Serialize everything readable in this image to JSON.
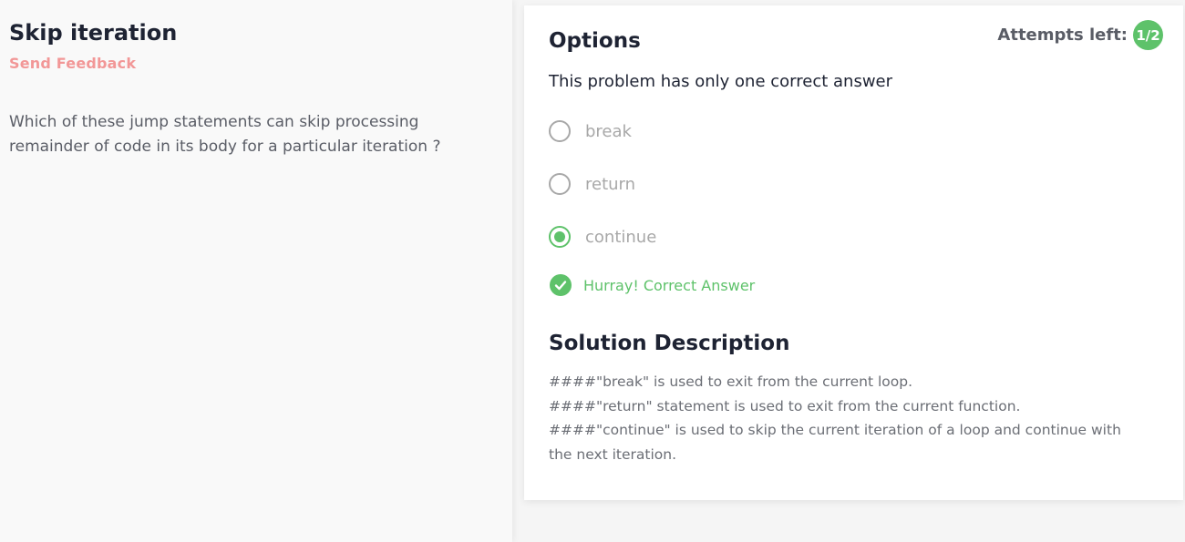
{
  "problem": {
    "title": "Skip iteration",
    "send_feedback": "Send Feedback",
    "question": "Which of these jump statements can skip processing remainder of code in its body for a particular iteration ?"
  },
  "options_panel": {
    "heading": "Options",
    "attempts_label": "Attempts left:",
    "attempts_value": "1/2",
    "subtitle": "This problem has only one correct answer",
    "options": [
      {
        "label": "break",
        "selected": false
      },
      {
        "label": "return",
        "selected": false
      },
      {
        "label": "continue",
        "selected": true
      }
    ],
    "result": "Hurray! Correct Answer"
  },
  "solution": {
    "heading": "Solution Description",
    "lines": [
      "####\"break\" is used to exit from the current loop.",
      "####\"return\" statement is used to exit from the current function.",
      "####\"continue\" is used to skip the current iteration of a loop and continue with the next iteration."
    ]
  },
  "colors": {
    "accent_green": "#5ec26a",
    "feedback_pink": "#f29797",
    "heading_dark": "#1e2333"
  },
  "icons": {
    "result": "check-circle-icon"
  }
}
